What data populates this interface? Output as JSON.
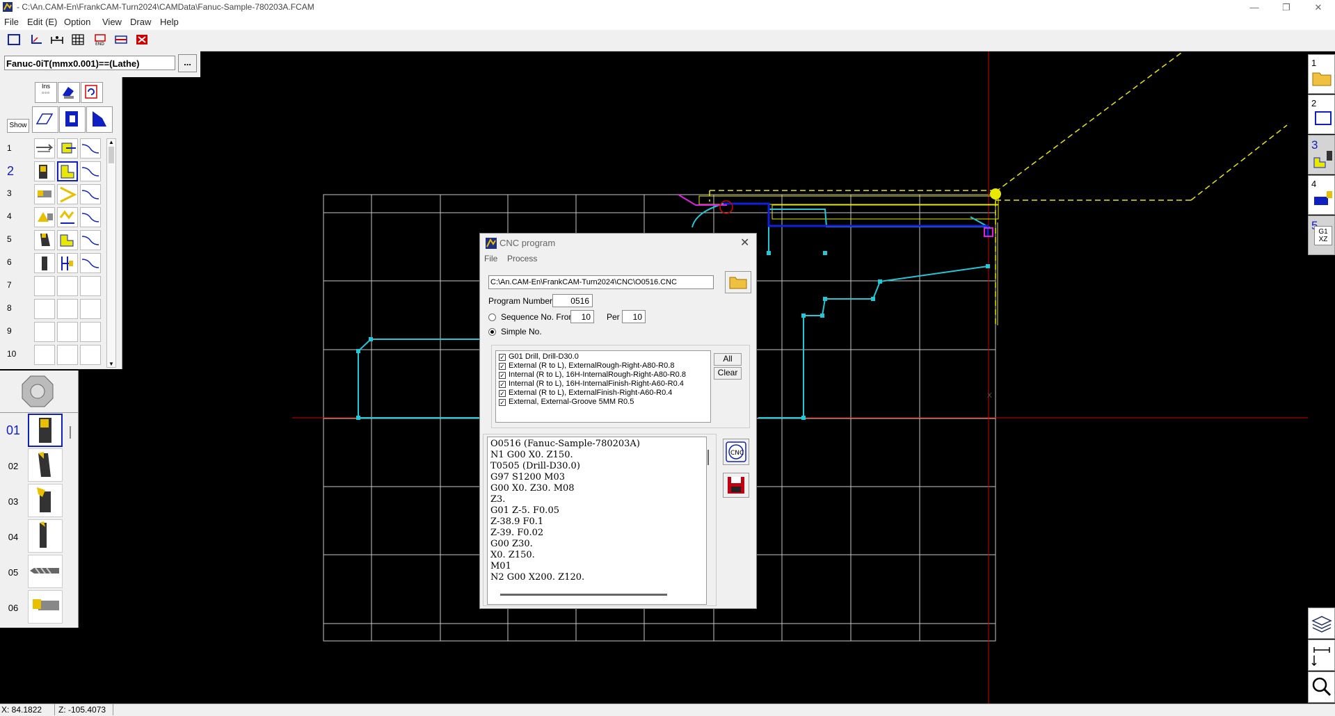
{
  "window": {
    "title": "- C:\\An.CAM-En\\FrankCAM-Turn2024\\CAMData\\Fanuc-Sample-780203A.FCAM",
    "minimize": "—",
    "maximize": "❐",
    "close": "✕"
  },
  "menubar": [
    "File",
    "Edit (E)",
    "Option",
    "View",
    "Draw",
    "Help"
  ],
  "controller": {
    "name": "Fanuc-0iT(mmx0.001)==(Lathe)",
    "browse_label": "..."
  },
  "palette": {
    "top_buttons": [
      "Ins",
      "Show"
    ],
    "rows": [
      "1",
      "2",
      "3",
      "4",
      "5",
      "6",
      "7",
      "8",
      "9",
      "10"
    ],
    "selected_row": "2"
  },
  "tools": {
    "numbers": [
      "01",
      "02",
      "03",
      "04",
      "05",
      "06"
    ],
    "selected": "01"
  },
  "right_tabs": [
    "1",
    "2",
    "3",
    "4",
    "5"
  ],
  "right_tab5_label": "G1 XZ",
  "status": {
    "x": "X: 84.1822",
    "z": "Z: -105.4073"
  },
  "dialog": {
    "title": "CNC program",
    "menu": [
      "File",
      "Process"
    ],
    "path": "C:\\An.CAM-En\\FrankCAM-Turn2024\\CNC\\O0516.CNC",
    "program_number_label": "Program Number",
    "program_number": "0516",
    "sequence_label": "Sequence No. From",
    "sequence_from": "10",
    "per_label": "Per",
    "per_value": "10",
    "simple_label": "Simple No.",
    "operations": [
      "G01 Drill, Drill-D30.0",
      "External (R to L), ExternalRough-Right-A80-R0.8",
      "Internal (R to L), 16H-InternalRough-Right-A80-R0.8",
      "Internal (R to L), 16H-InternalFinish-Right-A60-R0.4",
      "External (R to L), ExternalFinish-Right-A60-R0.4",
      "External, External-Groove 5MM R0.5"
    ],
    "all_label": "All",
    "clear_label": "Clear",
    "code": [
      "O0516 (Fanuc-Sample-780203A)",
      "N1 G00 X0. Z150.",
      "T0505 (Drill-D30.0)",
      "G97 S1200 M03",
      "G00 X0. Z30. M08",
      "Z3.",
      "G01 Z-5. F0.05",
      "Z-38.9 F0.1",
      "Z-39. F0.02",
      "G00 Z30.",
      "X0. Z150.",
      "M01",
      "N2 G00 X200. Z120."
    ],
    "cnc_icon_label": "CNC"
  },
  "colors": {
    "canvas": "#000000",
    "grid": "#c8c8c8",
    "toolpath": "#20c8d8",
    "rapid": "#e8e800",
    "finish": "#1020e0",
    "axis": "#d00000",
    "accent": "#1020c0"
  }
}
